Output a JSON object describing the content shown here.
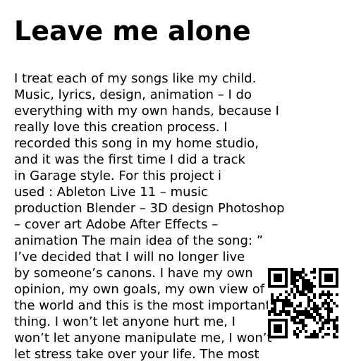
{
  "title": "Leave me alone",
  "body_lines": [
    "I treat each of my songs like my child.",
    "Music, lyrics, design, animation – I do",
    "everything with my own hands, because I",
    "really love this creation process.  I",
    "recorded this song in my home studio,",
    "and it was the first time I did a track",
    "in Garage style.  For this project i",
    "used : Ableton Live 11 – music",
    "production Blender – 3D design Photoshop",
    "– cover art Adobe After Effects –",
    "animation The main idea of the song: ”",
    "I’ve decided that I will no longer live",
    "by someone’s canons. I have my own",
    "opinion, my own goals, my own view of",
    "the world and this is the most important",
    "thing. I won’t let anyone hurt me, I",
    "won’t let anyone manipulate me, I won’t",
    "let stress take over your life. The most"
  ],
  "qr_code": {
    "icon": "qr-code-icon",
    "fg_color": "#000000",
    "bg_color": "#ffffff"
  }
}
